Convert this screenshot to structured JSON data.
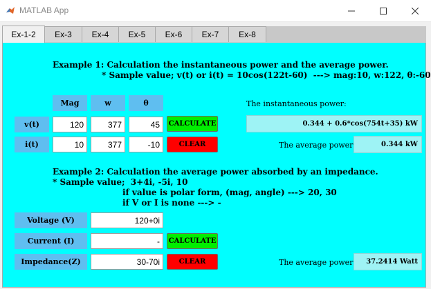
{
  "window": {
    "title": "MATLAB App",
    "minimize": "—",
    "maximize": "☐",
    "close": "✕"
  },
  "tabs": [
    {
      "label": "Ex-1-2",
      "active": true
    },
    {
      "label": "Ex-3"
    },
    {
      "label": "Ex-4"
    },
    {
      "label": "Ex-5"
    },
    {
      "label": "Ex-6"
    },
    {
      "label": "Ex-7"
    },
    {
      "label": "Ex-8"
    }
  ],
  "example1": {
    "heading": "Example 1: Calculation the instantaneous power and the average power.",
    "sample": "* Sample value; v(t) or i(t) = 10cos(122t-60)  ---> mag:10, w:122, θ:-60",
    "headers": {
      "mag": "Mag",
      "w": "w",
      "theta": "θ"
    },
    "v_row": {
      "label": "v(t)",
      "mag": "120",
      "w": "377",
      "theta": "45"
    },
    "i_row": {
      "label": "i(t)",
      "mag": "10",
      "w": "377",
      "theta": "-10"
    },
    "calculate": "CALCULATE",
    "clear": "CLEAR",
    "instantaneous_label": "The instantaneous power:",
    "instantaneous_value": "0.344 + 0.6*cos(754t+35) kW",
    "average_label": "The average power:",
    "average_value": "0.344 kW"
  },
  "example2": {
    "heading": "Example 2: Calculation the average power absorbed by an impedance.",
    "sample_line1": "* Sample value;  3+4i, -5i, 10",
    "sample_line2": "if value is polar form, (mag, angle) ---> 20, 30",
    "sample_line3": "if V or I is none ---> -",
    "voltage_label": "Voltage (V)",
    "voltage_value": "120+0i",
    "current_label": "Current (I)",
    "current_value": "-",
    "impedance_label": "Impedance(Z)",
    "impedance_value": "30-70i",
    "calculate": "CALCULATE",
    "clear": "CLEAR",
    "average_label": "The average power:",
    "average_value": "37.2414 Watt"
  },
  "colors": {
    "panel": "#00ffff",
    "header": "#5fbef0",
    "calculate": "#00ee00",
    "clear": "#ff0000",
    "output": "#9ef3f5"
  }
}
